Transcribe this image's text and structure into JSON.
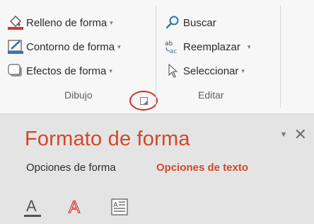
{
  "ribbon": {
    "dibujo": {
      "label": "Dibujo",
      "items": [
        {
          "label": "Relleno de forma",
          "icon": "shape-fill-icon"
        },
        {
          "label": "Contorno de forma",
          "icon": "shape-outline-icon"
        },
        {
          "label": "Efectos de forma",
          "icon": "shape-effects-icon"
        }
      ],
      "launcher_icon": "dialog-launcher-icon"
    },
    "editar": {
      "label": "Editar",
      "items": [
        {
          "label": "Buscar",
          "icon": "search-icon"
        },
        {
          "label": "Reemplazar",
          "icon": "replace-icon"
        },
        {
          "label": "Seleccionar",
          "icon": "select-cursor-icon"
        }
      ]
    }
  },
  "pane": {
    "title": "Formato de forma",
    "tabs": [
      {
        "label": "Opciones de forma",
        "active": false
      },
      {
        "label": "Opciones de texto",
        "active": true
      }
    ],
    "icons": [
      "text-fill-icon",
      "text-outline-icon",
      "text-box-icon"
    ]
  },
  "colors": {
    "accent": "#d24726",
    "highlight_circle": "#c9302c",
    "fill_red": "#d9342b",
    "outline_blue": "#2e75b6"
  }
}
